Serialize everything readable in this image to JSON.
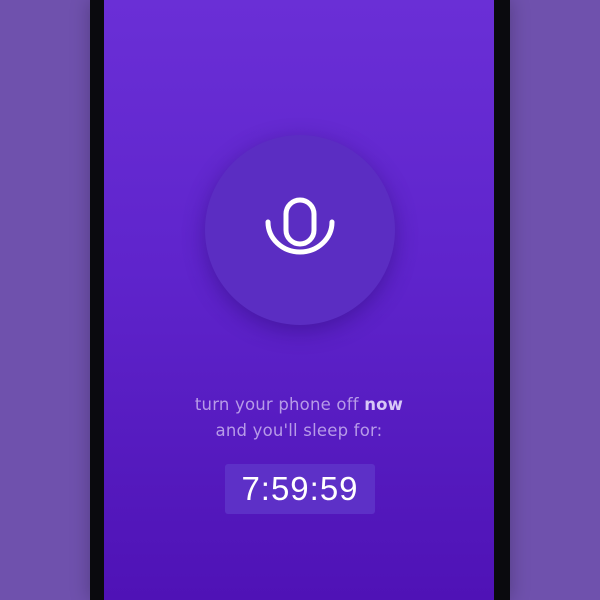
{
  "app": {
    "accent_color": "#5b2dc2",
    "background_color": "#6f51ad"
  },
  "record_button": {
    "icon": "microphone-icon"
  },
  "message": {
    "line1_prefix": "turn your phone off ",
    "line1_emphasis": "now",
    "line2": "and you'll sleep for:"
  },
  "timer": {
    "value": "7:59:59"
  }
}
